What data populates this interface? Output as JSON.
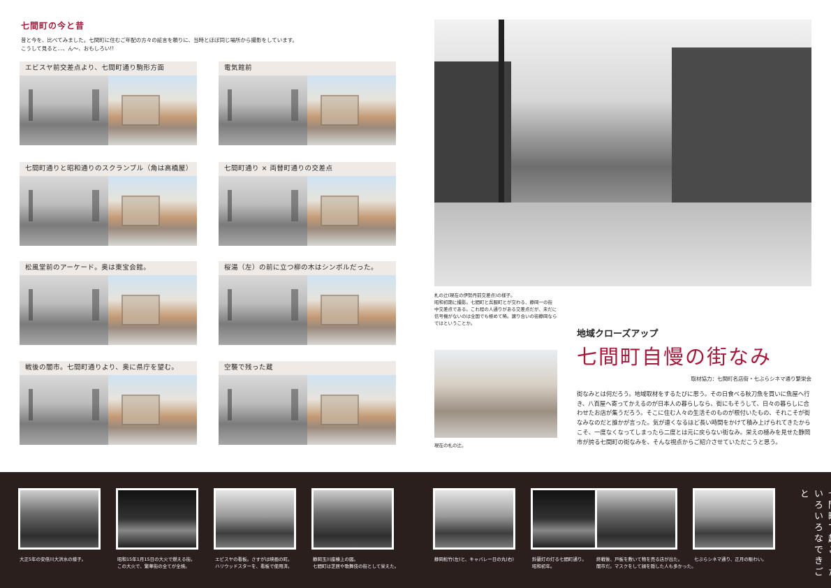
{
  "left": {
    "section_title": "七間町の今と昔",
    "intro": [
      "昔と今を、比べてみました。七間町に住むご年配の方々の証言を頼りに、当時とほぼ同じ場所から撮影をしています。",
      "こうして見ると…、ん〜、おもしろい!!"
    ],
    "cards": [
      {
        "caption": "エビスヤ前交差点より、七間町通り駒形方面"
      },
      {
        "caption": "電気館前"
      },
      {
        "caption": "七間町通りと昭和通りのスクランブル（角は高橋屋）"
      },
      {
        "caption": "七間町通り × 両替町通りの交差点"
      },
      {
        "caption": "松風堂前のアーケード。奥は東宝会館。"
      },
      {
        "caption": "桜湯（左）の前に立つ柳の木はシンボルだった。"
      },
      {
        "caption": "戦後の闇市。七間町通りより、奥に県庁を望む。"
      },
      {
        "caption": "空襲で残った蔵"
      }
    ]
  },
  "right": {
    "big_caption": [
      "札の辻(現在の伊勢丹前交差点)の様子。",
      "昭和初期に撮影。七間町と呉服町とが交わる、静岡一の街",
      "中交差点である。これ程の人通りがある交差点だが、未だに",
      "信号機がないのは全国でも極めて稀。譲り合いの街静岡なら",
      "ではということか。"
    ],
    "small_caption": "現在の札の辻。",
    "closeup_label": "地域クローズアップ",
    "main_title": "七間町自慢の街なみ",
    "credit": "取材協力：七間町名店街・七ぶらシネマ通り繁栄会",
    "body": "街なみとは何だろう。地域取材をするたびに思う。その日食べる秋刀魚を買いに魚屋へ行き、八百屋へ寄ってかえるのが日本人の暮らしなら、街にもそうして、日々の暮らしに合わせたお店が集うだろう。そこに住む人々の生活そのものが根付いたもの、それこそが街なみなのだと誰かが言った。気が遠くなるほど長い時間をかけて積み上げられてきたからこそ、一度なくなってしまったら二度とは元に戻らない街なみ。栄えの極みを見せた静岡市が誇る七間町の街なみを、そんな視点からご紹介させていただこうと思う。"
  },
  "band": {
    "vertical_title": "七間町で起こった いろいろなできごと",
    "items": [
      {
        "caption": [
          "大正5年の安倍川大洪水の様子。"
        ]
      },
      {
        "caption": [
          "昭和15年1月15日の大火で燃える街。",
          "この大火で、繁華街の全てが全焼。"
        ]
      },
      {
        "caption": [
          "エビスヤの看板。さすがは映画の町。",
          "ハリウッドスターを、看板で使用済。"
        ]
      },
      {
        "caption": [
          "静岡玉川座棟上の図。",
          "七間町は芝居や歌舞伎の街として栄えた。"
        ]
      },
      {
        "caption": [
          "静岡松竹(左)と、キャバレー日の丸(右)"
        ]
      },
      {
        "caption": [
          "鈴蘭灯の灯る七間町通り。",
          "昭和初年。"
        ]
      },
      {
        "caption": [
          "終戦後、戸板を敷いて物を売る店が出た。",
          "闇市だ。マスクをして顔を隠した人も多かった。"
        ]
      },
      {
        "caption": [
          "七ぶらシネマ通り、正月の賑わい。"
        ]
      }
    ]
  }
}
